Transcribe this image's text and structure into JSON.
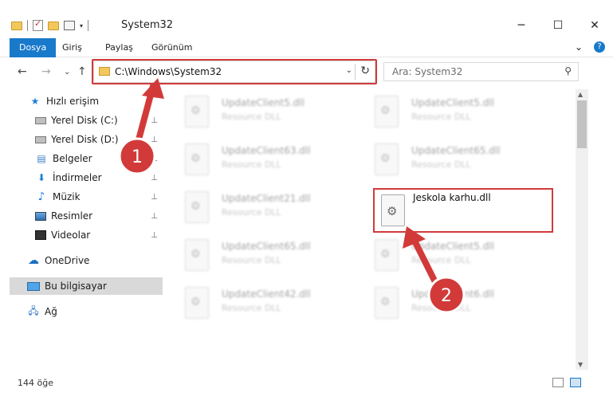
{
  "window": {
    "title": "System32",
    "minimize": "─",
    "maximize": "☐",
    "close": "✕"
  },
  "ribbon": {
    "tabs": [
      "Dosya",
      "Giriş",
      "Paylaş",
      "Görünüm"
    ],
    "expand": "⌄",
    "help": "?"
  },
  "nav": {
    "back": "←",
    "forward": "→",
    "recent": "⌄",
    "up": "↑"
  },
  "address": {
    "path": "C:\\Windows\\System32",
    "dropdown": "⌄",
    "refresh": "↻"
  },
  "search": {
    "placeholder": "Ara: System32",
    "icon": "⚲"
  },
  "sidebar": {
    "items": [
      {
        "label": "Hızlı erişim",
        "icon": "star-icon"
      },
      {
        "label": "Yerel Disk (C:)",
        "icon": "disk-icon",
        "pinned": true
      },
      {
        "label": "Yerel Disk (D:)",
        "icon": "disk-icon",
        "pinned": true
      },
      {
        "label": "Belgeler",
        "icon": "document-icon",
        "pinned": true
      },
      {
        "label": "İndirmeler",
        "icon": "download-icon",
        "pinned": true
      },
      {
        "label": "Müzik",
        "icon": "music-icon",
        "pinned": true
      },
      {
        "label": "Resimler",
        "icon": "picture-icon",
        "pinned": true
      },
      {
        "label": "Videolar",
        "icon": "video-icon",
        "pinned": true
      },
      {
        "label": "OneDrive",
        "icon": "cloud-icon"
      },
      {
        "label": "Bu bilgisayar",
        "icon": "computer-icon",
        "selected": true
      },
      {
        "label": "Ağ",
        "icon": "network-icon"
      }
    ],
    "pin_glyph": "📌"
  },
  "files": [
    {
      "name": "UpdateClient5.dll",
      "type": "Resource DLL"
    },
    {
      "name": "UpdateClient5.dll",
      "type": "Resource DLL"
    },
    {
      "name": "UpdateClient63.dll",
      "type": "Resource DLL"
    },
    {
      "name": "UpdateClient65.dll",
      "type": "Resource DLL"
    },
    {
      "name": "UpdateClient21.dll",
      "type": "Resource DLL"
    },
    {
      "name": "UpdateClient65.dll",
      "type": "Resource DLL"
    },
    {
      "name": "UpdateClient5.dll",
      "type": "Resource DLL"
    },
    {
      "name": "UpdateClient42.dll",
      "type": "Resource DLL"
    },
    {
      "name": "UpdateClient6.dll",
      "type": "Resource DLL"
    }
  ],
  "target_file": {
    "name": "Jeskola karhu.dll"
  },
  "annotations": {
    "step1": "1",
    "step2": "2",
    "color": "#d23a3a"
  },
  "status": {
    "count": "144 öğe"
  }
}
